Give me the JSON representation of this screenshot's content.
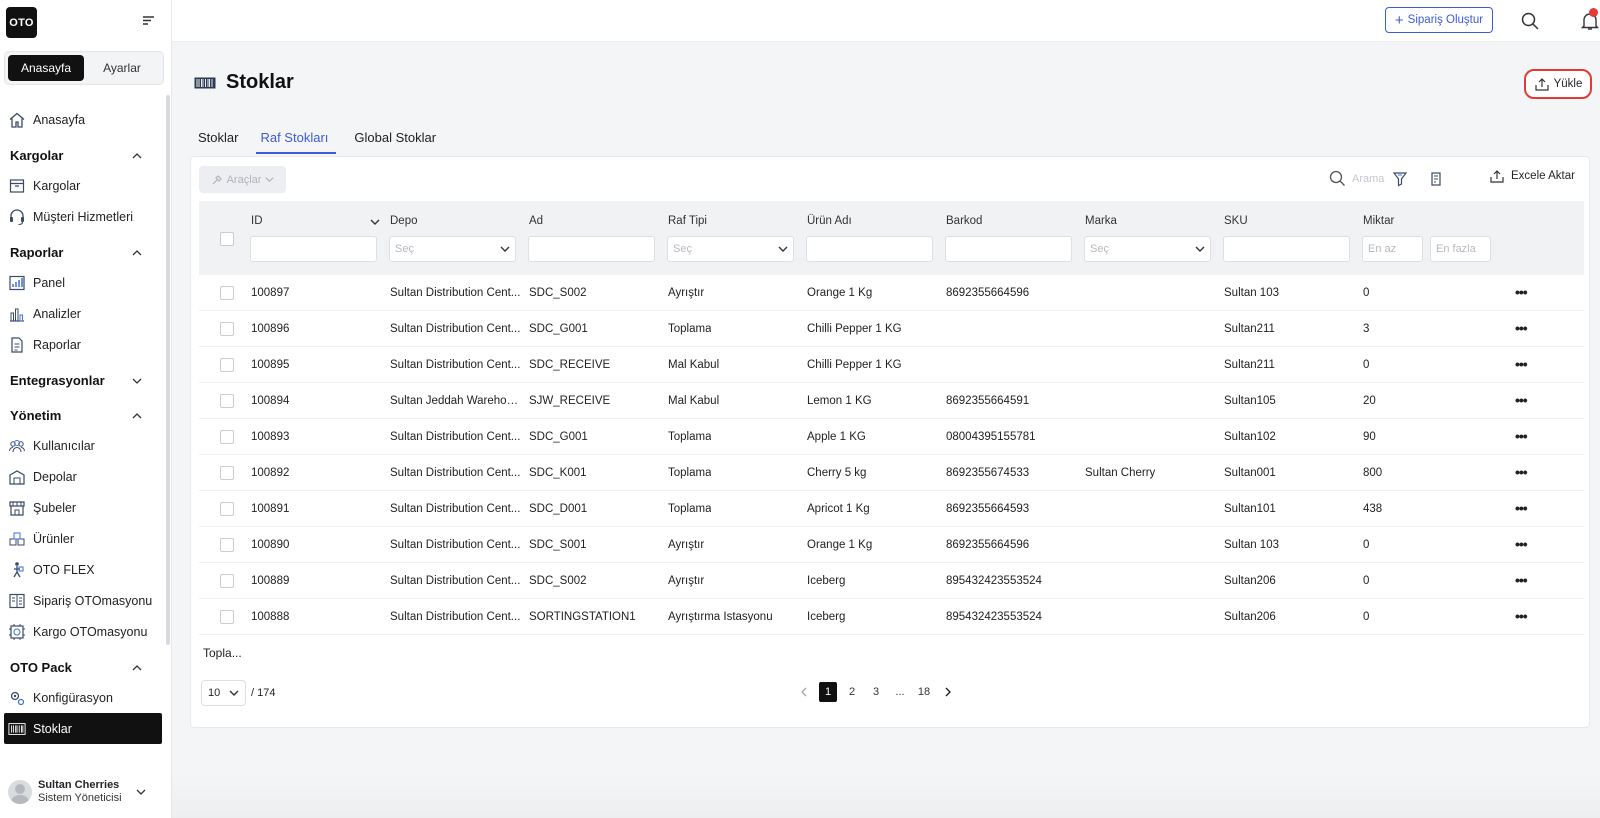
{
  "app": {
    "logo": "OTO"
  },
  "sidebar": {
    "segments": [
      "Anasayfa",
      "Ayarlar"
    ],
    "home": "Anasayfa",
    "sections": [
      {
        "title": "Kargolar",
        "items": [
          "Kargolar",
          "Müşteri Hizmetleri"
        ]
      },
      {
        "title": "Raporlar",
        "items": [
          "Panel",
          "Analizler",
          "Raporlar"
        ]
      },
      {
        "title": "Entegrasyonlar",
        "items": []
      },
      {
        "title": "Yönetim",
        "items": [
          "Kullanıcılar",
          "Depolar",
          "Şubeler",
          "Ürünler",
          "OTO FLEX",
          "Sipariş OTOmasyonu",
          "Kargo OTOmasyonu"
        ]
      },
      {
        "title": "OTO Pack",
        "items": [
          "Konfigürasyon",
          "Stoklar"
        ]
      }
    ],
    "user": {
      "name": "Sultan Cherries",
      "role": "Sistem Yöneticisi"
    }
  },
  "topbar": {
    "create_order": "Sipariş Oluştur"
  },
  "page": {
    "title": "Stoklar",
    "upload": "Yükle",
    "tabs": [
      "Stoklar",
      "Raf Stokları",
      "Global Stoklar"
    ],
    "active_tab": 1
  },
  "toolbar": {
    "tools": "Araçlar",
    "search_placeholder": "Arama",
    "export": "Excele Aktar"
  },
  "table": {
    "headers": {
      "id": "ID",
      "depo": "Depo",
      "ad": "Ad",
      "raf_tipi": "Raf Tipi",
      "urun_adi": "Ürün Adı",
      "barkod": "Barkod",
      "marka": "Marka",
      "sku": "SKU",
      "miktar": "Miktar"
    },
    "filters": {
      "depo": "Seç",
      "raf_tipi": "Seç",
      "marka": "Seç",
      "miktar_min": "En az",
      "miktar_max": "En fazla"
    },
    "rows": [
      {
        "id": "100897",
        "depo": "Sultan Distribution Cent...",
        "ad": "SDC_S002",
        "raf_tipi": "Ayrıştır",
        "urun_adi": "Orange 1 Kg",
        "barkod": "8692355664596",
        "marka": "",
        "sku": "Sultan 103",
        "miktar": "0"
      },
      {
        "id": "100896",
        "depo": "Sultan Distribution Cent...",
        "ad": "SDC_G001",
        "raf_tipi": "Toplama",
        "urun_adi": "Chilli Pepper 1 KG",
        "barkod": "",
        "marka": "",
        "sku": "Sultan211",
        "miktar": "3"
      },
      {
        "id": "100895",
        "depo": "Sultan Distribution Cent...",
        "ad": "SDC_RECEIVE",
        "raf_tipi": "Mal Kabul",
        "urun_adi": "Chilli Pepper 1 KG",
        "barkod": "",
        "marka": "",
        "sku": "Sultan211",
        "miktar": "0"
      },
      {
        "id": "100894",
        "depo": "Sultan Jeddah Warehou...",
        "ad": "SJW_RECEIVE",
        "raf_tipi": "Mal Kabul",
        "urun_adi": "Lemon 1 KG",
        "barkod": "8692355664591",
        "marka": "",
        "sku": "Sultan105",
        "miktar": "20"
      },
      {
        "id": "100893",
        "depo": "Sultan Distribution Cent...",
        "ad": "SDC_G001",
        "raf_tipi": "Toplama",
        "urun_adi": "Apple 1 KG",
        "barkod": "08004395155781",
        "marka": "",
        "sku": "Sultan102",
        "miktar": "90"
      },
      {
        "id": "100892",
        "depo": "Sultan Distribution Cent...",
        "ad": "SDC_K001",
        "raf_tipi": "Toplama",
        "urun_adi": "Cherry 5 kg",
        "barkod": "8692355674533",
        "marka": "Sultan Cherry",
        "sku": "Sultan001",
        "miktar": "800"
      },
      {
        "id": "100891",
        "depo": "Sultan Distribution Cent...",
        "ad": "SDC_D001",
        "raf_tipi": "Toplama",
        "urun_adi": "Apricot 1 Kg",
        "barkod": "8692355664593",
        "marka": "",
        "sku": "Sultan101",
        "miktar": "438"
      },
      {
        "id": "100890",
        "depo": "Sultan Distribution Cent...",
        "ad": "SDC_S001",
        "raf_tipi": "Ayrıştır",
        "urun_adi": "Orange 1 Kg",
        "barkod": "8692355664596",
        "marka": "",
        "sku": "Sultan 103",
        "miktar": "0"
      },
      {
        "id": "100889",
        "depo": "Sultan Distribution Cent...",
        "ad": "SDC_S002",
        "raf_tipi": "Ayrıştır",
        "urun_adi": "Iceberg",
        "barkod": "895432423553524",
        "marka": "",
        "sku": "Sultan206",
        "miktar": "0"
      },
      {
        "id": "100888",
        "depo": "Sultan Distribution Cent...",
        "ad": "SORTINGSTATION1",
        "raf_tipi": "Ayrıştırma İstasyonu",
        "urun_adi": "Iceberg",
        "barkod": "895432423553524",
        "marka": "",
        "sku": "Sultan206",
        "miktar": "0"
      }
    ]
  },
  "footer": {
    "total_label": "Topla...",
    "page_size": "10",
    "total_count": "/ 174",
    "pages": [
      "1",
      "2",
      "3",
      "...",
      "18"
    ],
    "current_page": "1"
  },
  "colors": {
    "accent": "#3d5bd9",
    "highlight": "#e53935",
    "dark": "#111111"
  }
}
